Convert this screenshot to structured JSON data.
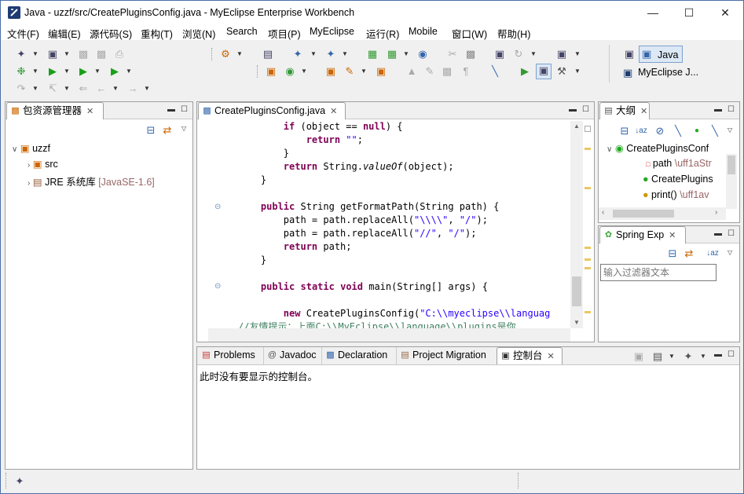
{
  "window": {
    "title": "Java  -  uzzf/src/CreatePluginsConfig.java  -  MyEclipse Enterprise Workbench"
  },
  "menu": [
    "文件(F)",
    "编辑(E)",
    "源代码(S)",
    "重构(T)",
    "浏览(N)",
    "Search",
    "项目(P)",
    "MyEclipse",
    "运行(R)",
    "Mobile",
    "窗口(W)",
    "帮助(H)"
  ],
  "perspectives": {
    "java": "Java",
    "myeclipse": "MyEclipse J..."
  },
  "package_explorer": {
    "tab": "包资源管理器",
    "project": "uzzf",
    "src": "src",
    "jre": "JRE 系统库",
    "jre_version": "[JavaSE-1.6]"
  },
  "editor": {
    "tab": "CreatePluginsConfig.java",
    "lines": [
      {
        "indent": "        ",
        "parts": [
          [
            "kw",
            "if"
          ],
          [
            "n",
            " (object == "
          ],
          [
            "kw",
            "null"
          ],
          [
            "n",
            ") {"
          ]
        ]
      },
      {
        "indent": "            ",
        "parts": [
          [
            "kw",
            "return"
          ],
          [
            "n",
            " "
          ],
          [
            "str",
            "\"\""
          ],
          [
            "n",
            ";"
          ]
        ]
      },
      {
        "indent": "        ",
        "parts": [
          [
            "n",
            "}"
          ]
        ]
      },
      {
        "indent": "        ",
        "parts": [
          [
            "kw",
            "return"
          ],
          [
            "n",
            " String."
          ],
          [
            "i",
            "valueOf"
          ],
          [
            "n",
            "(object);"
          ]
        ]
      },
      {
        "indent": "    ",
        "parts": [
          [
            "n",
            "}"
          ]
        ]
      },
      {
        "indent": "",
        "parts": [
          [
            "n",
            ""
          ]
        ]
      },
      {
        "indent": "    ",
        "parts": [
          [
            "kw",
            "public"
          ],
          [
            "n",
            " String getFormatPath(String path) {"
          ]
        ]
      },
      {
        "indent": "        ",
        "parts": [
          [
            "n",
            "path = path.replaceAll("
          ],
          [
            "str",
            "\"\\\\\\\\\""
          ],
          [
            "n",
            ", "
          ],
          [
            "str",
            "\"/\""
          ],
          [
            "n",
            ");"
          ]
        ]
      },
      {
        "indent": "        ",
        "parts": [
          [
            "n",
            "path = path.replaceAll("
          ],
          [
            "str",
            "\"//\""
          ],
          [
            "n",
            ", "
          ],
          [
            "str",
            "\"/\""
          ],
          [
            "n",
            ");"
          ]
        ]
      },
      {
        "indent": "        ",
        "parts": [
          [
            "kw",
            "return"
          ],
          [
            "n",
            " path;"
          ]
        ]
      },
      {
        "indent": "    ",
        "parts": [
          [
            "n",
            "}"
          ]
        ]
      },
      {
        "indent": "",
        "parts": [
          [
            "n",
            ""
          ]
        ]
      },
      {
        "indent": "    ",
        "parts": [
          [
            "kw",
            "public"
          ],
          [
            "n",
            " "
          ],
          [
            "kw",
            "static"
          ],
          [
            "n",
            " "
          ],
          [
            "kw",
            "void"
          ],
          [
            "n",
            " main(String[] args) {"
          ]
        ]
      },
      {
        "indent": "",
        "parts": [
          [
            "n",
            ""
          ]
        ]
      },
      {
        "indent": "        ",
        "parts": [
          [
            "kw",
            "new"
          ],
          [
            "n",
            " CreatePluginsConfig("
          ],
          [
            "str",
            "\"C:\\\\myeclipse\\\\languag"
          ]
        ]
      },
      {
        "indent": "",
        "parts": [
          [
            "cmt",
            "//友情提示：上面C:\\\\MyEclipse\\\\language\\\\plugins是你"
          ]
        ]
      }
    ]
  },
  "outline": {
    "tab": "大纲",
    "class": "CreatePluginsConf",
    "field": "path",
    "field_type": "\\uff1aStr",
    "ctor": "CreatePlugins",
    "method": "print()",
    "method_type": "\\uff1av"
  },
  "spring": {
    "tab": "Spring Exp",
    "filter_placeholder": "输入过滤器文本"
  },
  "bottom": {
    "tabs": [
      "Problems",
      "Javadoc",
      "Declaration",
      "Project Migration",
      "控制台"
    ],
    "message": "此时没有要显示的控制台。"
  }
}
